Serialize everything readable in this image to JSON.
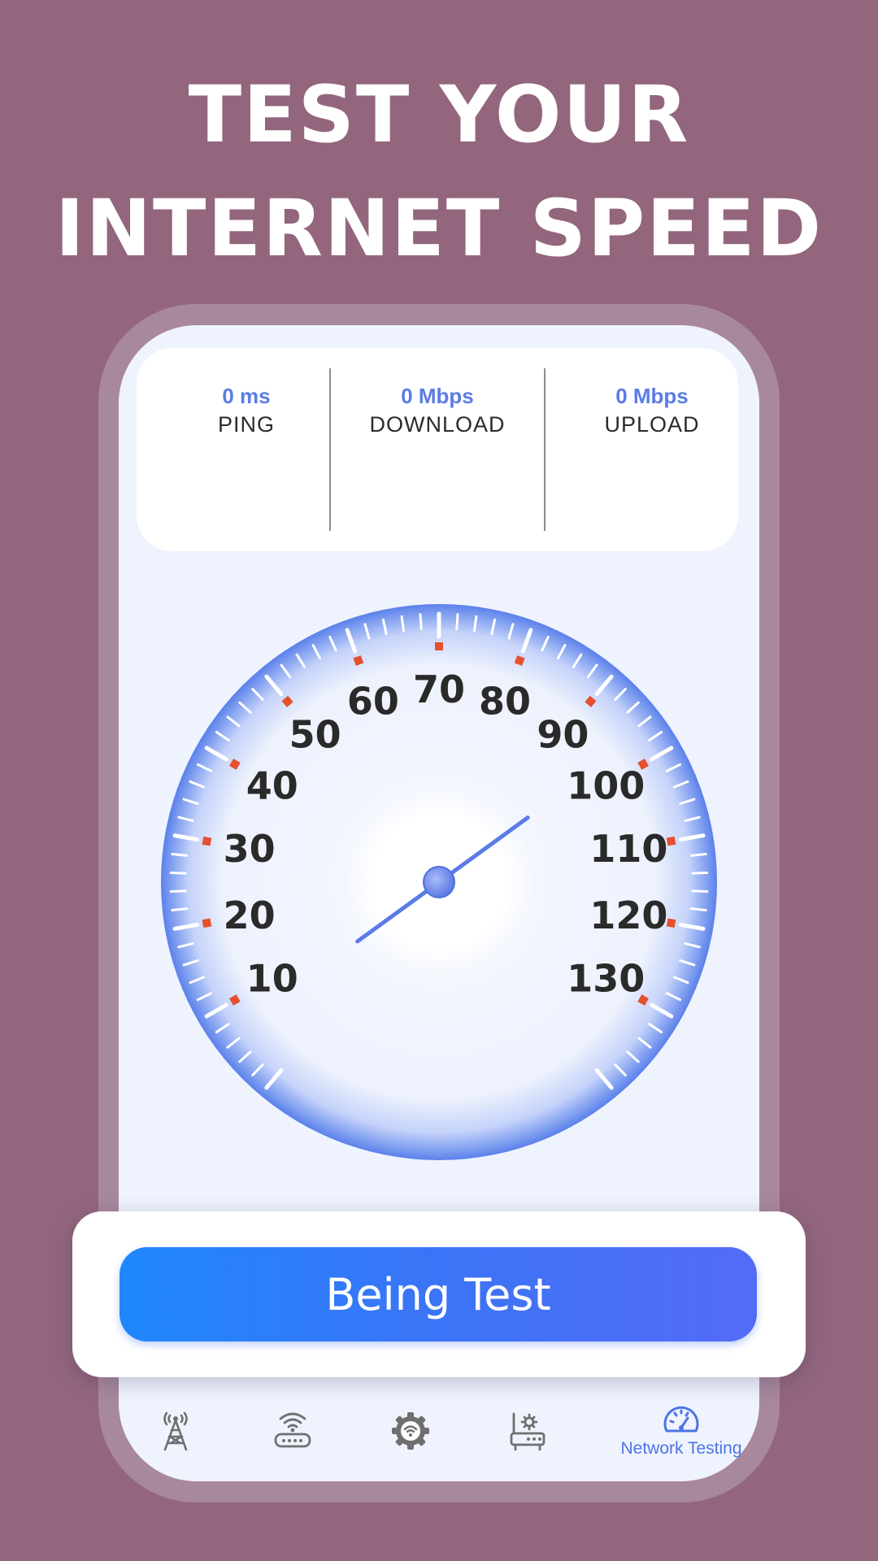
{
  "headline": {
    "line1": "TEST YOUR",
    "line2": "INTERNET SPEED"
  },
  "stats": [
    {
      "value": "0 ms",
      "label": "PING"
    },
    {
      "value": "0 Mbps",
      "label": "DOWNLOAD"
    },
    {
      "value": "0 Mbps",
      "label": "UPLOAD"
    }
  ],
  "gauge": {
    "scale_labels": [
      "10",
      "20",
      "30",
      "40",
      "50",
      "60",
      "70",
      "80",
      "90",
      "100",
      "110",
      "120",
      "130"
    ],
    "needle_reading": 97,
    "accent_color": "#5b7be6",
    "marker_color": "#e5502e"
  },
  "action": {
    "button_label": "Being Test"
  },
  "nav": {
    "items": [
      {
        "icon": "cell-tower-icon",
        "label": ""
      },
      {
        "icon": "router-wifi-icon",
        "label": ""
      },
      {
        "icon": "wifi-settings-icon",
        "label": ""
      },
      {
        "icon": "router-settings-icon",
        "label": ""
      },
      {
        "icon": "speedometer-icon",
        "label": "Network Testing",
        "active": true
      }
    ]
  }
}
